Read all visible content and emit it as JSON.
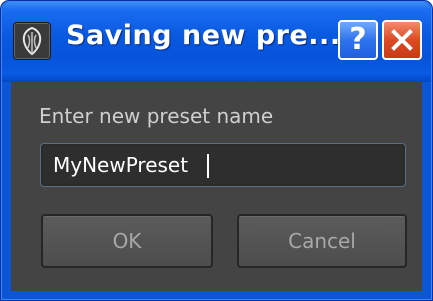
{
  "window": {
    "title": "Saving new pre...",
    "help_label": "?",
    "icons": {
      "app": "app-logo-icon",
      "close": "close-icon"
    }
  },
  "dialog": {
    "prompt": "Enter new preset name",
    "input_value": "MyNewPreset",
    "ok_label": "OK",
    "cancel_label": "Cancel"
  },
  "colors": {
    "titlebar": "#0858e0",
    "close_button": "#dd4a25",
    "content_background": "#444444",
    "input_background": "#2e2e2e"
  }
}
